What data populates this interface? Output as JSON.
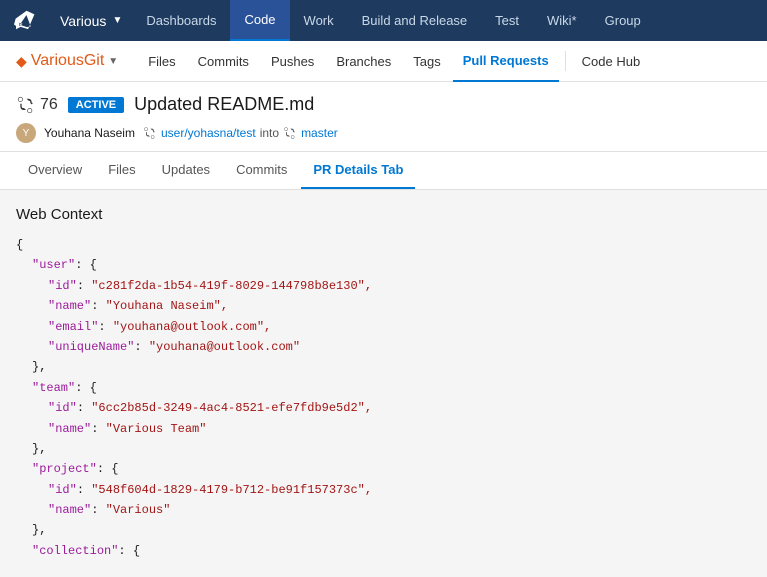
{
  "topNav": {
    "logoLabel": "Azure DevOps",
    "projectName": "Various",
    "items": [
      {
        "label": "Dashboards",
        "active": false
      },
      {
        "label": "Code",
        "active": true
      },
      {
        "label": "Work",
        "active": false
      },
      {
        "label": "Build and Release",
        "active": false
      },
      {
        "label": "Test",
        "active": false
      },
      {
        "label": "Wiki*",
        "active": false
      },
      {
        "label": "Group",
        "active": false
      }
    ]
  },
  "repoBar": {
    "repoName": "VariousGit",
    "navItems": [
      {
        "label": "Files",
        "active": false
      },
      {
        "label": "Commits",
        "active": false
      },
      {
        "label": "Pushes",
        "active": false
      },
      {
        "label": "Branches",
        "active": false
      },
      {
        "label": "Tags",
        "active": false
      },
      {
        "label": "Pull Requests",
        "active": true
      },
      {
        "label": "Code Hub",
        "active": false
      }
    ]
  },
  "pr": {
    "prIconText": "⑃",
    "prNumber": "76",
    "badgeText": "ACTIVE",
    "title": "Updated README.md",
    "authorName": "Youhana Naseim",
    "branchFrom": "user/yohasna/test",
    "branchInto": "into",
    "branchTo": "master",
    "tabs": [
      {
        "label": "Overview",
        "active": false
      },
      {
        "label": "Files",
        "active": false
      },
      {
        "label": "Updates",
        "active": false
      },
      {
        "label": "Commits",
        "active": false
      },
      {
        "label": "PR Details Tab",
        "active": true
      }
    ]
  },
  "webContext": {
    "title": "Web Context",
    "json": {
      "userId": "c281f2da-1b54-419f-8029-144798b8e130",
      "userName": "Youhana Naseim",
      "userEmail": "youhana@outlook.com",
      "userUniqueName": "youhana@outlook.com",
      "teamId": "6cc2b85d-3249-4ac4-8521-efe7fdb9e5d2",
      "teamName": "Various Team",
      "projectId": "548f604d-1829-4179-b712-be91f157373c",
      "projectName": "Various",
      "collectionLabel": "collection"
    }
  }
}
